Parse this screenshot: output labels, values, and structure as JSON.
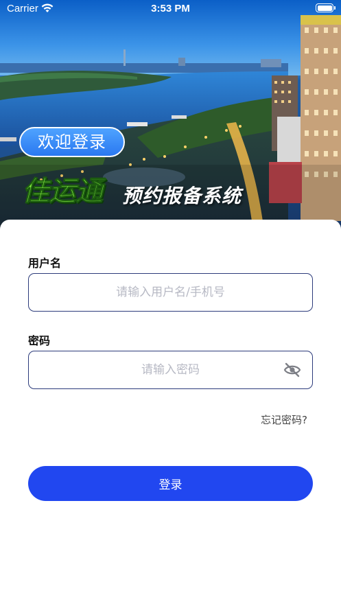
{
  "status_bar": {
    "carrier": "Carrier",
    "time": "3:53 PM"
  },
  "hero": {
    "welcome": "欢迎登录",
    "brand": "佳运通",
    "system_name": "预约报备系统"
  },
  "form": {
    "username": {
      "label": "用户名",
      "placeholder": "请输入用户名/手机号",
      "value": ""
    },
    "password": {
      "label": "密码",
      "placeholder": "请输入密码",
      "value": "",
      "toggle_icon": "eye-slash-icon"
    },
    "forgot_password": "忘记密码?",
    "login_button": "登录"
  },
  "colors": {
    "primary": "#2147f0",
    "input_border": "#2b3a7a",
    "placeholder": "#b7b9c4",
    "brand_green": "#7be33b"
  }
}
